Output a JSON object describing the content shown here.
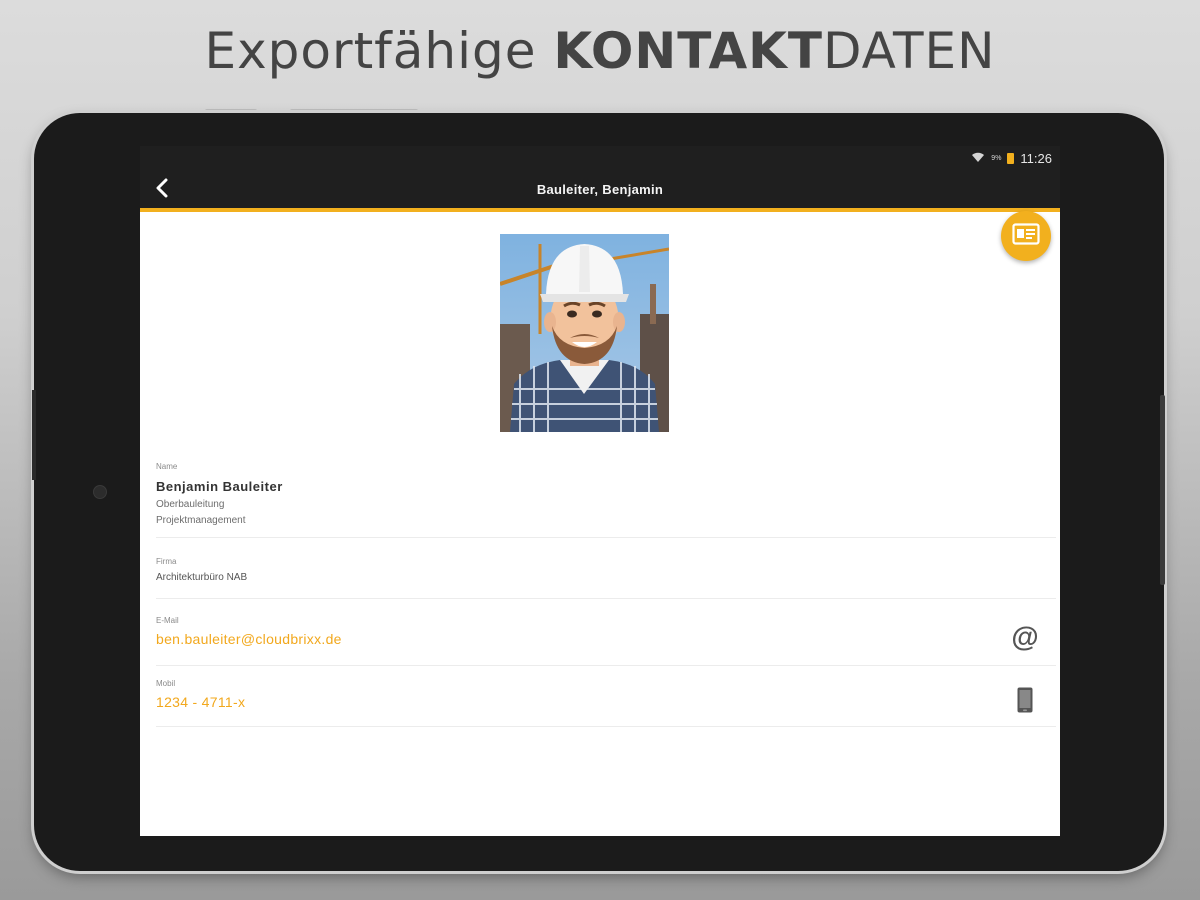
{
  "headline": {
    "light": "Exportfähige ",
    "bold": "KONTAKT",
    "light2": "DATEN"
  },
  "statusbar": {
    "time": "11:26",
    "battery_text": "9%"
  },
  "appbar": {
    "title": "Bauleiter, Benjamin"
  },
  "contact": {
    "name_label": "Name",
    "name": "Benjamin Bauleiter",
    "role": "Oberbauleitung",
    "department": "Projektmanagement",
    "company_label": "Firma",
    "company": "Architekturbüro NAB",
    "email_label": "E-Mail",
    "email": "ben.bauleiter@cloudbrixx.de",
    "mobile_label": "Mobil",
    "mobile": "1234 - 4711-x"
  },
  "colors": {
    "accent": "#f2b01e",
    "link": "#f2a81d",
    "appbar": "#1f1f1f"
  },
  "icons": {
    "back": "chevron-left-icon",
    "fab": "contact-card-icon",
    "email": "at-sign-icon",
    "mobile": "smartphone-icon",
    "wifi": "wifi-icon",
    "battery": "battery-icon"
  }
}
